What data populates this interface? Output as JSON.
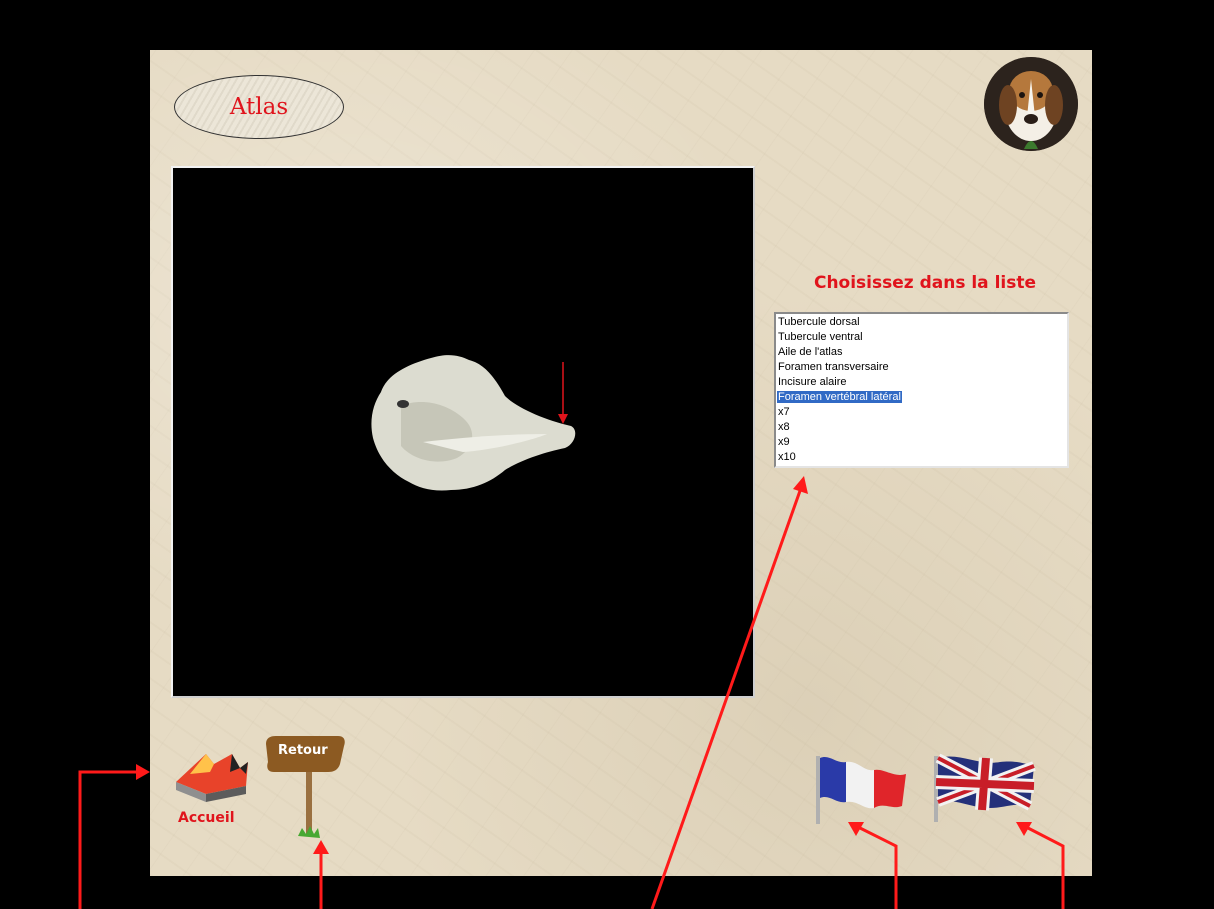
{
  "title": "Atlas",
  "list_heading": "Choisissez dans la liste",
  "list_items": [
    "Tubercule dorsal",
    "Tubercule ventral",
    "Aile de l'atlas",
    "Foramen transversaire",
    "Incisure alaire",
    "Foramen vertébral latéral",
    "x7",
    "x8",
    "x9",
    "x10"
  ],
  "selected_item": "Foramen vertébral latéral",
  "buttons": {
    "home_label": "Accueil",
    "back_label": "Retour"
  },
  "icons": {
    "home": "home-arrow-icon",
    "back": "signpost-icon",
    "french": "french-flag-icon",
    "english": "uk-flag-icon",
    "avatar": "beagle-avatar"
  },
  "colors": {
    "accent_red": "#e0141c",
    "panel_bg": "#e6dbc4",
    "selection": "#316ac5"
  }
}
